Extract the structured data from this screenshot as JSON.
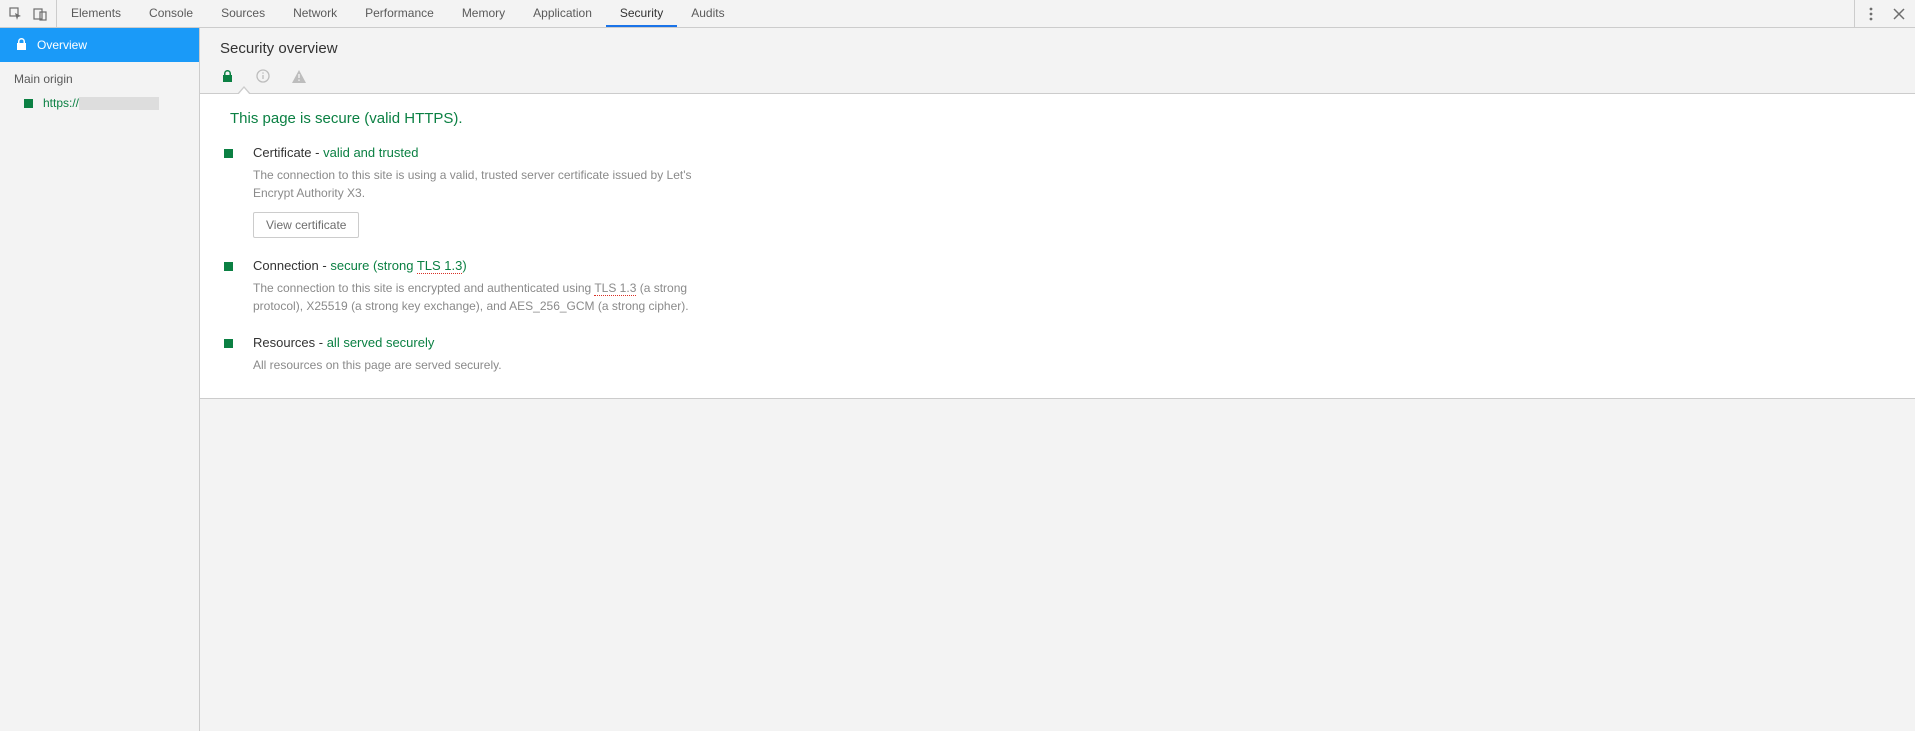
{
  "tabs": [
    "Elements",
    "Console",
    "Sources",
    "Network",
    "Performance",
    "Memory",
    "Application",
    "Security",
    "Audits"
  ],
  "activeTab": "Security",
  "sidebar": {
    "overview": "Overview",
    "sectionTitle": "Main origin",
    "originPrefix": "https://"
  },
  "header": {
    "title": "Security overview"
  },
  "overview": {
    "headline": "This page is secure (valid HTTPS).",
    "certificate": {
      "label": "Certificate",
      "value": "valid and trusted",
      "description": "The connection to this site is using a valid, trusted server certificate issued by Let's Encrypt Authority X3.",
      "button": "View certificate"
    },
    "connection": {
      "label": "Connection",
      "valuePrefix": "secure (strong ",
      "valueTls": "TLS 1.3",
      "valueSuffix": ")",
      "descPrefix": "The connection to this site is encrypted and authenticated using ",
      "descTls": "TLS 1.3",
      "descSuffix": " (a strong protocol), X25519 (a strong key exchange), and AES_256_GCM (a strong cipher)."
    },
    "resources": {
      "label": "Resources",
      "value": "all served securely",
      "description": "All resources on this page are served securely."
    }
  }
}
